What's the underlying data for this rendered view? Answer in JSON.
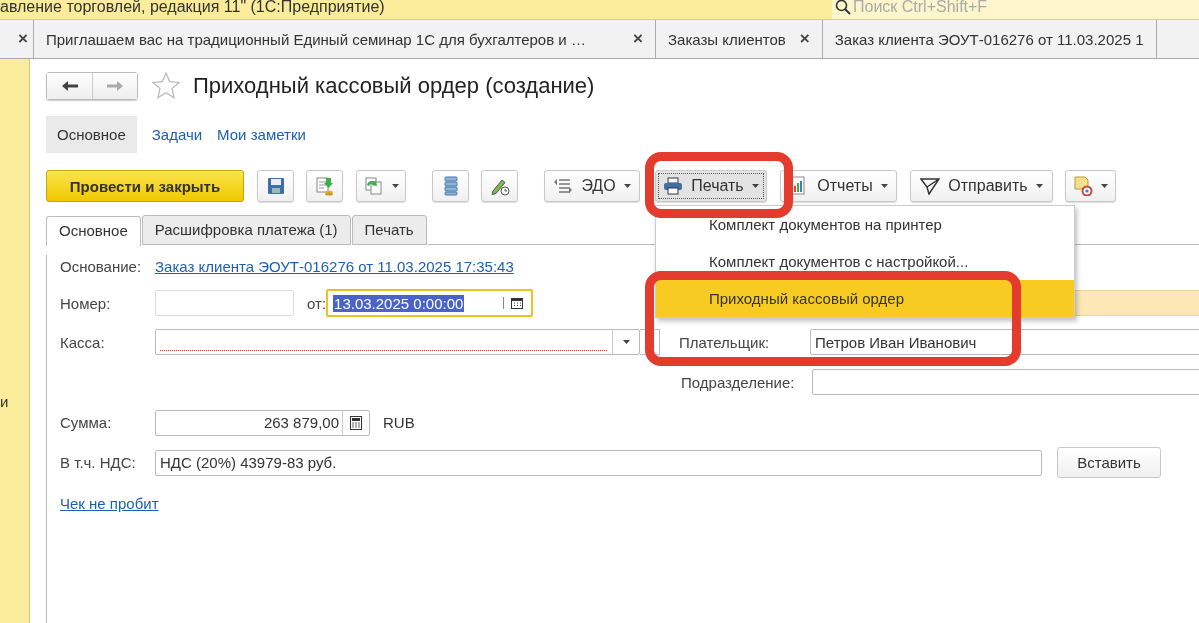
{
  "window": {
    "title": "авление торговлей, редакция 11\" (1С:Предприятие)"
  },
  "search": {
    "placeholder": "Поиск Ctrl+Shift+F"
  },
  "open_tabs": [
    {
      "close": "×"
    },
    {
      "label": "Приглашаем вас на традиционный Единый семинар 1С для бухгалтеров и …",
      "close": "×"
    },
    {
      "label": "Заказы клиентов",
      "close": "×"
    },
    {
      "label": "Заказ клиента ЭОУТ-016276 от 11.03.2025 1"
    }
  ],
  "sidebar": {
    "items": [
      "и"
    ]
  },
  "nav": {
    "back": {
      "disabled": false
    },
    "forward": {
      "disabled": true
    }
  },
  "document": {
    "title": "Приходный кассовый ордер (создание)",
    "favorite": false
  },
  "sections": [
    {
      "label": "Основное",
      "selected": true
    },
    {
      "label": "Задачи",
      "selected": false
    },
    {
      "label": "Мои заметки",
      "selected": false
    }
  ],
  "toolbar": {
    "primary": "Провести и закрыть",
    "buttons": [
      {
        "kind": "icon",
        "pressed": false
      },
      {
        "kind": "icon",
        "pressed": false
      },
      {
        "kind": "icon-menu",
        "pressed": false
      },
      {
        "kind": "icon",
        "pressed": false
      },
      {
        "kind": "icon",
        "pressed": false
      },
      {
        "kind": "text-menu",
        "label": "ЭДО",
        "pressed": false
      },
      {
        "kind": "text-menu",
        "label": "Печать",
        "pressed": true
      },
      {
        "kind": "text-menu",
        "label": "Отчеты",
        "pressed": false
      },
      {
        "kind": "text-menu",
        "label": "Отправить",
        "pressed": false
      },
      {
        "kind": "icon-menu",
        "pressed": false
      }
    ]
  },
  "form_tabs": [
    {
      "label": "Основное",
      "selected": true
    },
    {
      "label": "Расшифровка платежа (1)",
      "selected": false
    },
    {
      "label": "Печать",
      "selected": false
    }
  ],
  "form": {
    "basis": {
      "label": "Основание:",
      "link": "Заказ клиента ЭОУТ-016276 от 11.03.2025 17:35:43"
    },
    "number": {
      "label": "Номер:"
    },
    "date": {
      "label": "от:",
      "value": "13.03.2025  0:00:00",
      "focused": true
    },
    "right_field": {
      "highlighted": true
    },
    "cash_desk": {
      "label": "Касса:",
      "required": true
    },
    "payer": {
      "label": "Плательщик:",
      "value": "Петров Иван Иванович"
    },
    "department": {
      "label": "Подразделение:"
    },
    "amount": {
      "label": "Сумма:",
      "value": "263 879,00",
      "currency": "RUB"
    },
    "vat": {
      "label": "В т.ч. НДС:",
      "value": "НДС (20%) 43979-83 руб.",
      "button": "Вставить"
    },
    "receipt_link": "Чек не пробит"
  },
  "print_menu": {
    "items": [
      {
        "label": "Комплект документов на принтер",
        "selected": false
      },
      {
        "label": "Комплект документов с настройкой...",
        "selected": false
      },
      {
        "label": "Приходный кассовый ордер",
        "selected": true
      }
    ]
  },
  "annotations": [
    {
      "kind": "frame"
    },
    {
      "kind": "frame"
    }
  ]
}
